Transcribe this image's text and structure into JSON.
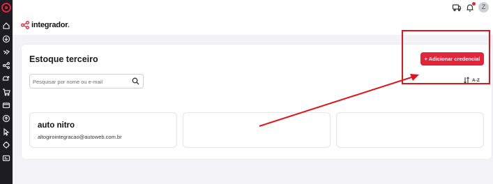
{
  "app": {
    "brand": "integrador",
    "brand_dot": "."
  },
  "topbar": {
    "avatar_initial": "Z"
  },
  "page": {
    "title": "Estoque terceiro",
    "search_placeholder": "Pesquisar por nome ou e-mail",
    "add_button": "+ Adicionar credencial",
    "sort_label": "A-Z"
  },
  "cards": [
    {
      "name": "auto nitro",
      "email": "altogirointegracao@autoweb.com.br"
    },
    {
      "name": "",
      "email": ""
    },
    {
      "name": "",
      "email": ""
    }
  ],
  "icons": {
    "rail": [
      "home-icon",
      "download-icon",
      "bolt-icon",
      "share-icon",
      "car-add-icon",
      "cart-icon",
      "wallet-icon",
      "upload-circle-icon",
      "pointer-icon",
      "crosshair-icon",
      "id-card-icon"
    ],
    "topbar": [
      "truck-icon",
      "bell-icon"
    ]
  },
  "colors": {
    "accent": "#e3243b",
    "annotation": "#e0141b",
    "rail": "#1c1c22"
  }
}
